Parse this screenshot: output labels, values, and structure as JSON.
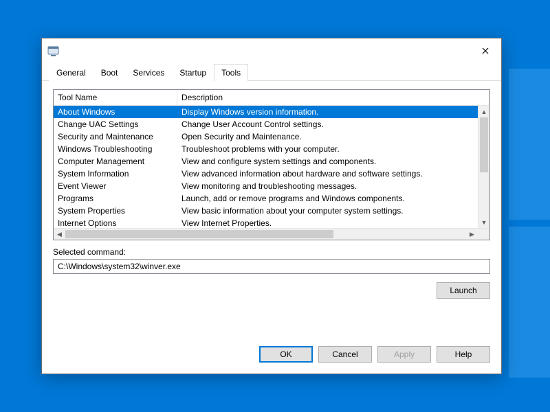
{
  "tabs": {
    "general": "General",
    "boot": "Boot",
    "services": "Services",
    "startup": "Startup",
    "tools": "Tools",
    "active": "tools"
  },
  "listview": {
    "header_name": "Tool Name",
    "header_desc": "Description",
    "selected_index": 0,
    "rows": [
      {
        "name": "About Windows",
        "desc": "Display Windows version information."
      },
      {
        "name": "Change UAC Settings",
        "desc": "Change User Account Control settings."
      },
      {
        "name": "Security and Maintenance",
        "desc": "Open Security and Maintenance."
      },
      {
        "name": "Windows Troubleshooting",
        "desc": "Troubleshoot problems with your computer."
      },
      {
        "name": "Computer Management",
        "desc": "View and configure system settings and components."
      },
      {
        "name": "System Information",
        "desc": "View advanced information about hardware and software settings."
      },
      {
        "name": "Event Viewer",
        "desc": "View monitoring and troubleshooting messages."
      },
      {
        "name": "Programs",
        "desc": "Launch, add or remove programs and Windows components."
      },
      {
        "name": "System Properties",
        "desc": "View basic information about your computer system settings."
      },
      {
        "name": "Internet Options",
        "desc": "View Internet Properties."
      }
    ]
  },
  "selected_cmd": {
    "label": "Selected command:",
    "value": "C:\\Windows\\system32\\winver.exe"
  },
  "buttons": {
    "launch": "Launch",
    "ok": "OK",
    "cancel": "Cancel",
    "apply": "Apply",
    "help": "Help"
  }
}
